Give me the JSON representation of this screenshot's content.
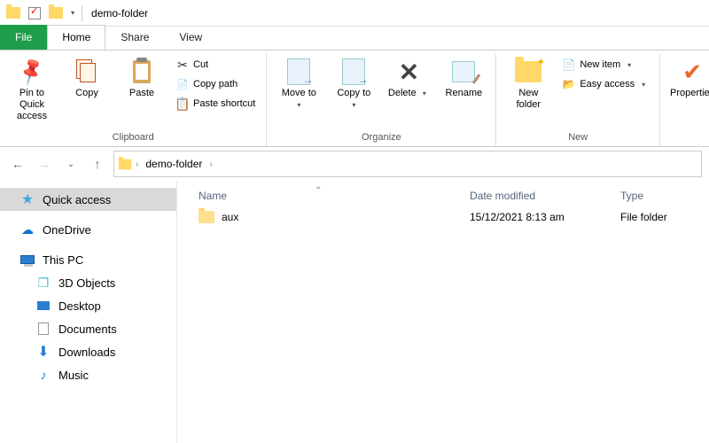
{
  "titlebar": {
    "title": "demo-folder"
  },
  "tabs": {
    "file": "File",
    "home": "Home",
    "share": "Share",
    "view": "View"
  },
  "ribbon": {
    "pin": "Pin to Quick access",
    "copy": "Copy",
    "paste": "Paste",
    "cut": "Cut",
    "copypath": "Copy path",
    "pasteshortcut": "Paste shortcut",
    "clipboard_label": "Clipboard",
    "moveto": "Move to",
    "copyto": "Copy to",
    "delete": "Delete",
    "rename": "Rename",
    "organize_label": "Organize",
    "newfolder": "New folder",
    "newitem": "New item",
    "easyaccess": "Easy access",
    "new_label": "New",
    "properties": "Properties"
  },
  "nav": {
    "crumb1": "demo-folder"
  },
  "sidebar": {
    "quick": "Quick access",
    "onedrive": "OneDrive",
    "thispc": "This PC",
    "objects3d": "3D Objects",
    "desktop": "Desktop",
    "documents": "Documents",
    "downloads": "Downloads",
    "music": "Music"
  },
  "filelist": {
    "hdr_name": "Name",
    "hdr_date": "Date modified",
    "hdr_type": "Type",
    "rows": [
      {
        "name": "aux",
        "date": "15/12/2021 8:13 am",
        "type": "File folder"
      }
    ]
  }
}
